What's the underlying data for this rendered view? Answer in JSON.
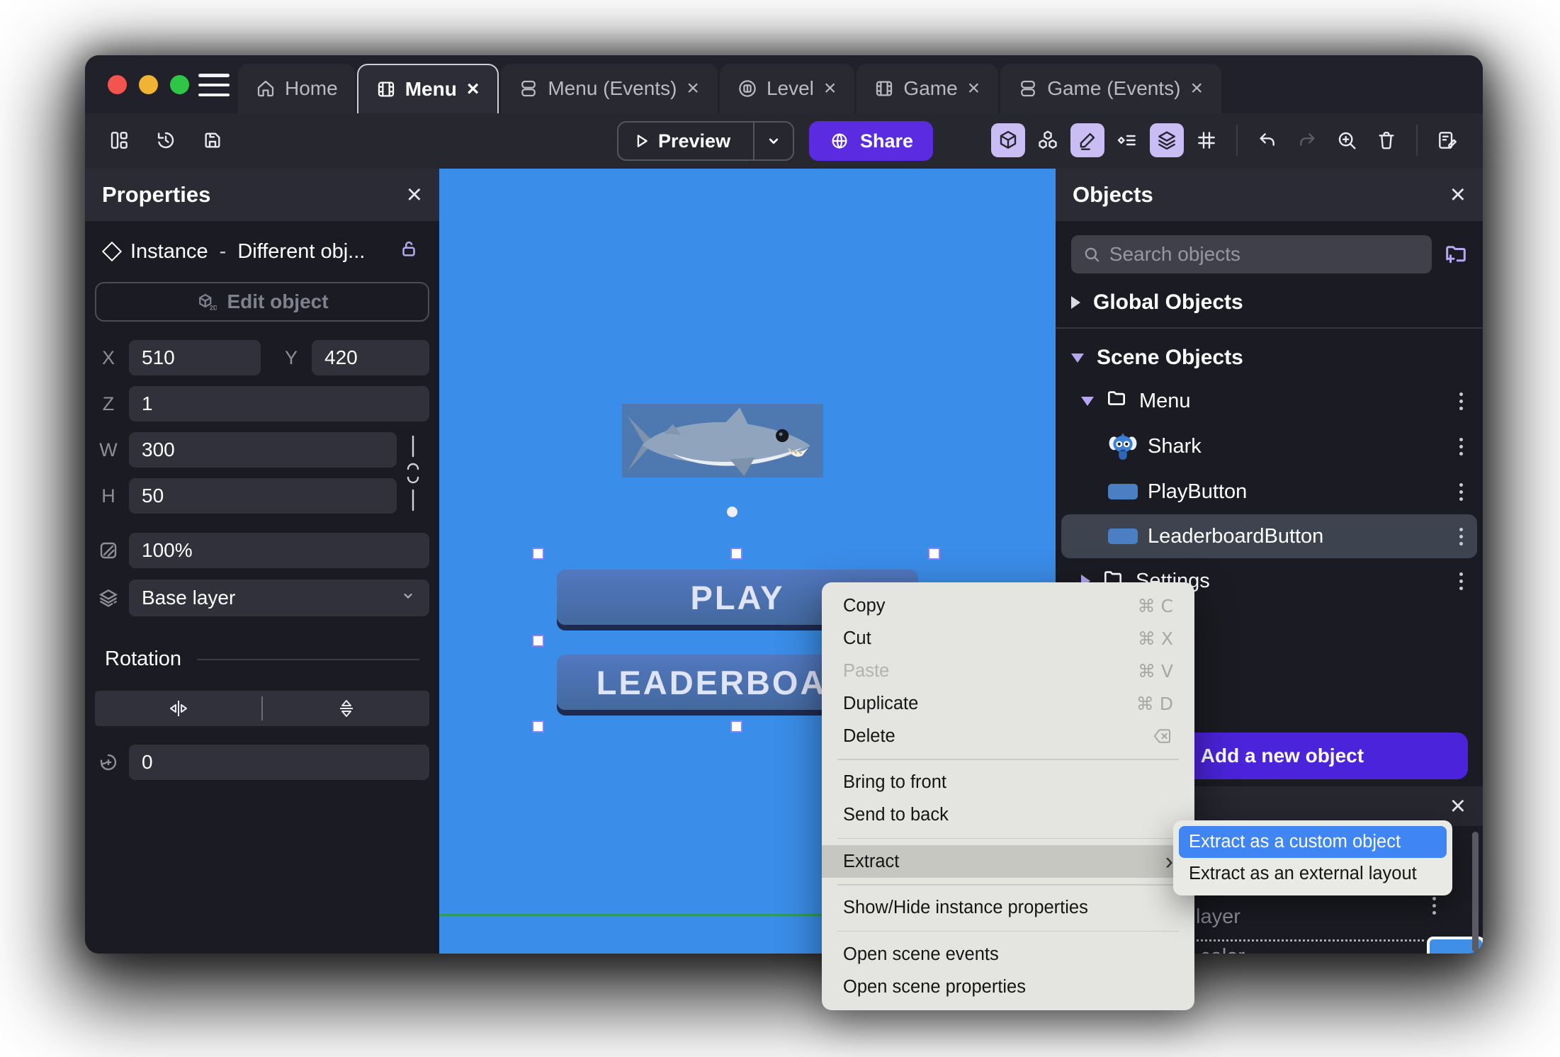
{
  "titlebar": {
    "tabs": [
      {
        "label": "Home"
      },
      {
        "label": "Menu",
        "close": "×"
      },
      {
        "label": "Menu (Events)",
        "close": "×"
      },
      {
        "label": "Level",
        "close": "×"
      },
      {
        "label": "Game",
        "close": "×"
      },
      {
        "label": "Game (Events)",
        "close": "×"
      }
    ]
  },
  "toolbar": {
    "preview_label": "Preview",
    "share_label": "Share"
  },
  "properties": {
    "title": "Properties",
    "close": "×",
    "instance_title": "Instance",
    "instance_sep": "-",
    "instance_name": "Different obj...",
    "edit_object_label": "Edit object",
    "edit_object_badge": "2D",
    "x_label": "X",
    "x_value": "510",
    "y_label": "Y",
    "y_value": "420",
    "z_label": "Z",
    "z_value": "1",
    "w_label": "W",
    "w_value": "300",
    "h_label": "H",
    "h_value": "50",
    "opacity_value": "100%",
    "layer_value": "Base layer",
    "rotation_title": "Rotation",
    "rotation_value": "0"
  },
  "canvas": {
    "play_label": "PLAY",
    "leaderboard_label": "LEADERBOARD",
    "colors": {
      "background": "#3a8de8",
      "button": "#4a72b8",
      "button_shadow": "#1e2a50",
      "scene_line": "#2f9b5f",
      "sprite_box": "#4e79b0",
      "handle_border": "#8f7ff2"
    }
  },
  "objects": {
    "title": "Objects",
    "close": "×",
    "search_placeholder": "Search objects",
    "global_group": "Global Objects",
    "scene_group": "Scene Objects",
    "items": {
      "menu_folder": "Menu",
      "shark": "Shark",
      "play_button": "PlayButton",
      "leaderboard_button": "LeaderboardButton",
      "settings_folder": "Settings"
    },
    "add_button_plus": "+",
    "add_button_label": "Add a new object",
    "bottom_panel": {
      "close": "×",
      "layer_fragment": "layer",
      "color_fragment": "d color",
      "swatch_color": "#3f8ee8"
    }
  },
  "context_menu": {
    "items": [
      {
        "label": "Copy",
        "shortcut": "⌘ C"
      },
      {
        "label": "Cut",
        "shortcut": "⌘ X"
      },
      {
        "label": "Paste",
        "shortcut": "⌘ V"
      },
      {
        "label": "Duplicate",
        "shortcut": "⌘ D"
      },
      {
        "label": "Delete"
      },
      {
        "label": "Bring to front"
      },
      {
        "label": "Send to back"
      },
      {
        "label": "Extract",
        "arrow": "›"
      },
      {
        "label": "Show/Hide instance properties"
      },
      {
        "label": "Open scene events"
      },
      {
        "label": "Open scene properties"
      }
    ]
  },
  "submenu": {
    "items": [
      {
        "label": "Extract as a custom object"
      },
      {
        "label": "Extract as an external layout"
      }
    ],
    "highlight_color": "#3f86f4"
  }
}
